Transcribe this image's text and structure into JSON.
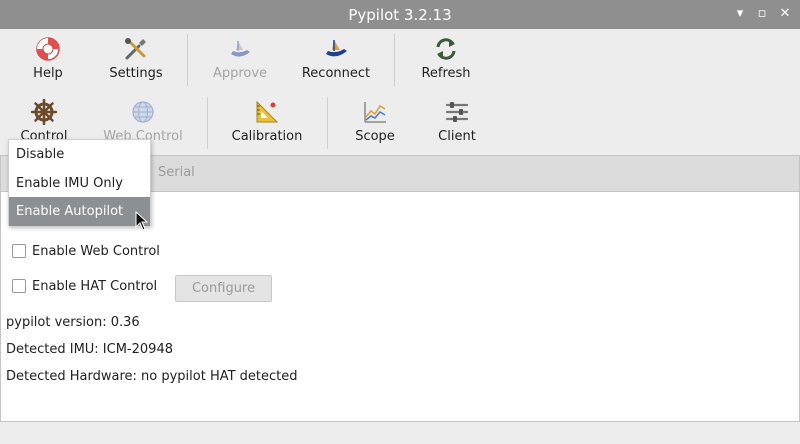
{
  "window": {
    "title": "Pypilot 3.2.13",
    "minimize_glyph": "▾",
    "maximize_glyph": "▫",
    "close_glyph": "✕"
  },
  "toolbar1": [
    {
      "label": "Help",
      "icon": "lifebuoy-icon",
      "enabled": true
    },
    {
      "label": "Settings",
      "icon": "tools-icon",
      "enabled": true
    },
    {
      "label": "Approve",
      "icon": "boat-icon",
      "enabled": false
    },
    {
      "label": "Reconnect",
      "icon": "boat-icon",
      "enabled": true
    },
    {
      "label": "Refresh",
      "icon": "refresh-icon",
      "enabled": true
    }
  ],
  "toolbar2": [
    {
      "label": "Control",
      "icon": "helm-icon",
      "enabled": true
    },
    {
      "label": "Web Control",
      "icon": "globe-icon",
      "enabled": false
    },
    {
      "label": "Calibration",
      "icon": "ruler-triangle-icon",
      "enabled": true
    },
    {
      "label": "Scope",
      "icon": "chart-icon",
      "enabled": true
    },
    {
      "label": "Client",
      "icon": "sliders-icon",
      "enabled": true
    }
  ],
  "tabs": {
    "serial": "Serial"
  },
  "checkboxes": {
    "web_control": {
      "label": "Enable Web Control",
      "checked": false
    },
    "hat_control": {
      "label": "Enable HAT Control",
      "checked": false
    }
  },
  "configure_button": "Configure",
  "info": {
    "version": "pypilot version: 0.36",
    "imu": "Detected IMU: ICM-20948",
    "hardware": "Detected Hardware: no pypilot HAT detected"
  },
  "dropdown": {
    "items": [
      "Disable",
      "Enable IMU Only",
      "Enable Autopilot"
    ],
    "selected": "Enable Autopilot"
  },
  "colors": {
    "titlebar": "#8f8f8f",
    "selected_item": "#8c8f93",
    "accent_blue": "#1e3f93"
  }
}
